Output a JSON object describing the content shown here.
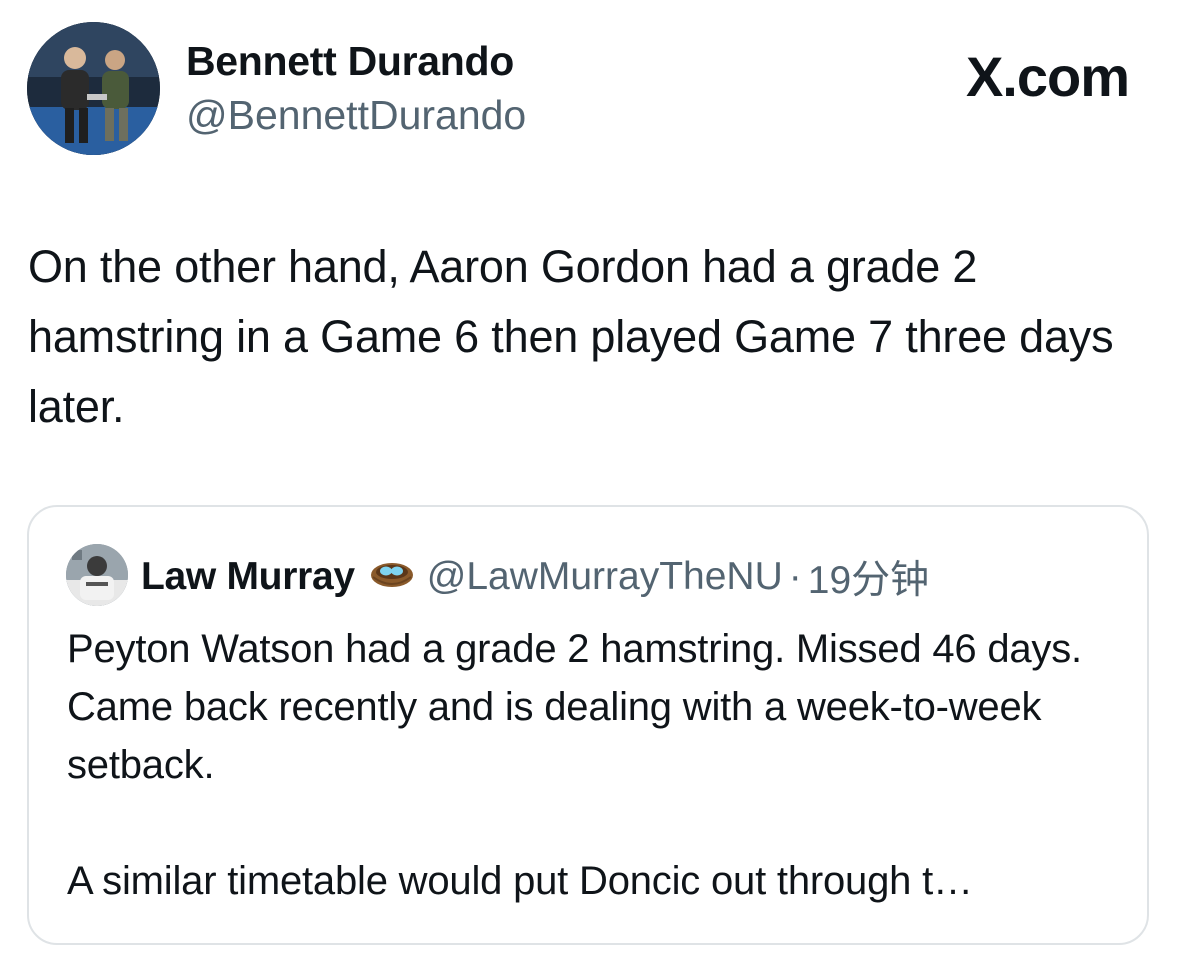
{
  "author": {
    "display_name": "Bennett Durando",
    "handle": "@BennettDurando",
    "avatar_icon": "profile-photo-icon"
  },
  "brand": {
    "label": "X.com"
  },
  "tweet": {
    "text": "On the other hand, Aaron Gordon had a grade 2 hamstring in a Game 6 then played Game 7 three days later."
  },
  "quoted_tweet": {
    "display_name": "Law Murray",
    "badge_icon": "nest-icon",
    "handle": "@LawMurrayTheNU",
    "separator": "·",
    "time": "19分钟",
    "paragraphs": [
      "Peyton Watson had a grade 2 hamstring. Missed 46 days. Came back recently and is dealing with a week-to-week setback.",
      "A similar timetable would put Doncic out through t…"
    ]
  },
  "colors": {
    "text_primary": "#0f1419",
    "text_secondary": "#536471",
    "border": "#dfe3e6",
    "background": "#ffffff"
  }
}
